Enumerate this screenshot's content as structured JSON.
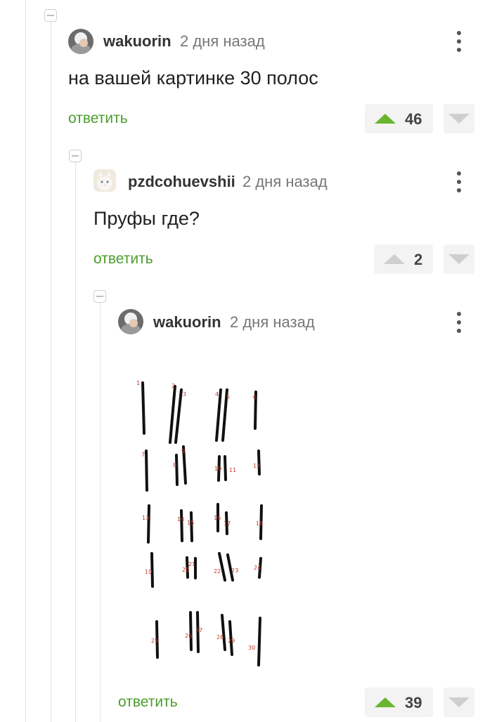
{
  "comments": [
    {
      "username": "wakuorin",
      "timestamp": "2 дня назад",
      "text": "на вашей картинке 30 полос",
      "reply": "ответить",
      "votes": "46",
      "upvoted": true,
      "avatar_icon": "avatar-icon"
    },
    {
      "username": "pzdcohuevshii",
      "timestamp": "2 дня назад",
      "text": "Пруфы где?",
      "reply": "ответить",
      "votes": "2",
      "upvoted": false,
      "avatar_icon": "cat-avatar-icon"
    },
    {
      "username": "wakuorin",
      "timestamp": "2 дня назад",
      "text": "",
      "reply": "ответить",
      "votes": "39",
      "upvoted": true,
      "avatar_icon": "avatar-icon"
    }
  ],
  "proof_image": {
    "labels": [
      "1",
      "2",
      "3",
      "4",
      "5",
      "6",
      "7",
      "8",
      "9",
      "10",
      "11",
      "12",
      "13",
      "14",
      "15",
      "16",
      "17",
      "18",
      "19",
      "20",
      "21",
      "22",
      "23",
      "24",
      "25",
      "26",
      "27",
      "28",
      "29",
      "30"
    ]
  },
  "colors": {
    "accent_green": "#4c9c2d",
    "upvote_green": "#6ab52f",
    "stroke_red": "#c0392b"
  }
}
